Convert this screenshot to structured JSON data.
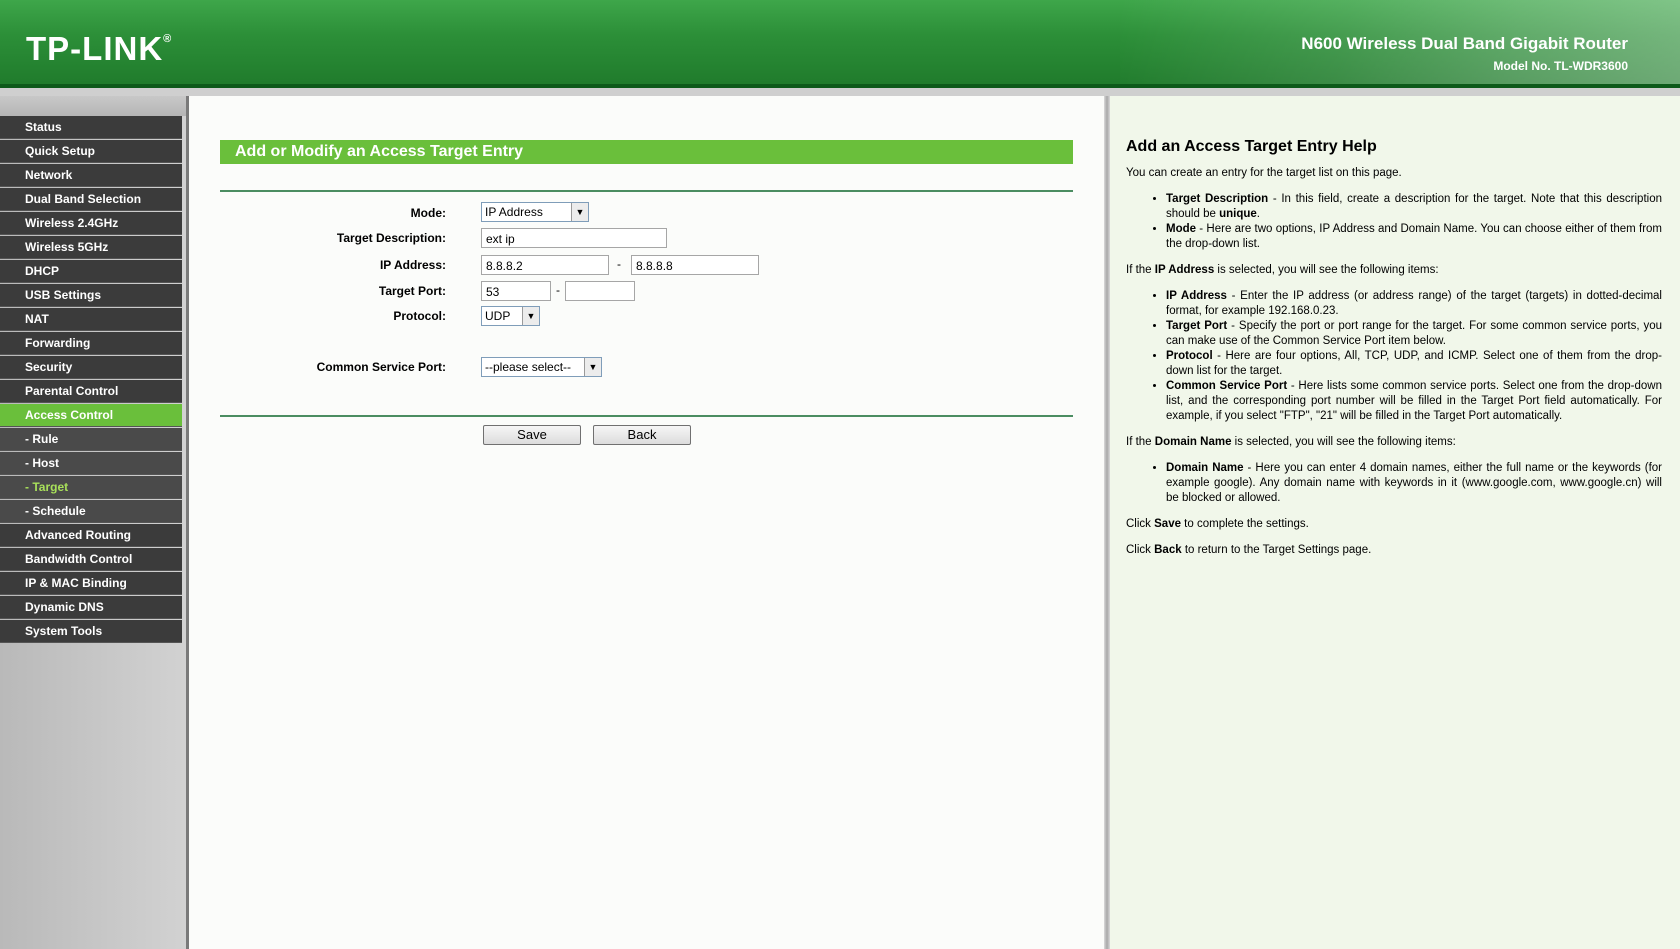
{
  "header": {
    "logo": "TP-LINK",
    "logo_mark": "®",
    "product": "N600 Wireless Dual Band Gigabit Router",
    "model": "Model No. TL-WDR3600"
  },
  "sidebar": {
    "items": [
      {
        "label": "Status"
      },
      {
        "label": "Quick Setup"
      },
      {
        "label": "Network"
      },
      {
        "label": "Dual Band Selection"
      },
      {
        "label": "Wireless 2.4GHz"
      },
      {
        "label": "Wireless 5GHz"
      },
      {
        "label": "DHCP"
      },
      {
        "label": "USB Settings"
      },
      {
        "label": "NAT"
      },
      {
        "label": "Forwarding"
      },
      {
        "label": "Security"
      },
      {
        "label": "Parental Control"
      },
      {
        "label": "Access Control"
      },
      {
        "label": "- Rule"
      },
      {
        "label": "- Host"
      },
      {
        "label": "- Target"
      },
      {
        "label": "- Schedule"
      },
      {
        "label": "Advanced Routing"
      },
      {
        "label": "Bandwidth Control"
      },
      {
        "label": "IP & MAC Binding"
      },
      {
        "label": "Dynamic DNS"
      },
      {
        "label": "System Tools"
      }
    ]
  },
  "form": {
    "title": "Add or Modify an Access Target Entry",
    "mode_label": "Mode:",
    "mode_value": "IP Address",
    "desc_label": "Target Description:",
    "desc_value": "ext ip",
    "ip_label": "IP Address:",
    "ip_start": "8.8.8.2",
    "ip_end": "8.8.8.8",
    "port_label": "Target Port:",
    "port_start": "53",
    "port_end": "",
    "protocol_label": "Protocol:",
    "protocol_value": "UDP",
    "csp_label": "Common Service Port:",
    "csp_value": "--please select--",
    "dash": "-",
    "save": "Save",
    "back": "Back"
  },
  "help": {
    "title": "Add an Access Target Entry Help",
    "intro": "You can create an entry for the target list on this page.",
    "td_term": "Target Description",
    "td_text": " - In this field, create a description for the target. Note that this description should be ",
    "td_unique": "unique",
    "td_end": ".",
    "mode_term": "Mode",
    "mode_text": " - Here are two options, IP Address and Domain Name. You can choose either of them from the drop-down list.",
    "ip_intro_pre": "If the ",
    "ip_intro_term": "IP Address",
    "ip_intro_post": " is selected, you will see the following items:",
    "ip_term": "IP Address",
    "ip_text": " - Enter the IP address (or address range) of the target (targets) in dotted-decimal format, for example 192.168.0.23.",
    "tp_term": "Target Port",
    "tp_text": " - Specify the port or port range for the target. For some common service ports, you can make use of the Common Service Port item below.",
    "proto_term": "Protocol",
    "proto_text": " - Here are four options, All, TCP, UDP, and ICMP. Select one of them from the drop-down list for the target.",
    "csp_term": "Common Service Port",
    "csp_text": " - Here lists some common service ports. Select one from the drop-down list, and the corresponding port number will be filled in the Target Port field automatically. For example, if you select \"FTP\", \"21\" will be filled in the Target Port automatically.",
    "dn_intro_pre": "If the ",
    "dn_intro_term": "Domain Name",
    "dn_intro_post": " is selected, you will see the following items:",
    "dn_term": "Domain Name",
    "dn_text": " - Here you can enter 4 domain names, either the full name or the keywords (for example google). Any domain name with keywords in it (www.google.com, www.google.cn) will be blocked or allowed.",
    "save_pre": "Click ",
    "save_term": "Save",
    "save_post": " to complete the settings.",
    "back_pre": "Click ",
    "back_term": "Back",
    "back_post": " to return to the Target Settings page."
  }
}
